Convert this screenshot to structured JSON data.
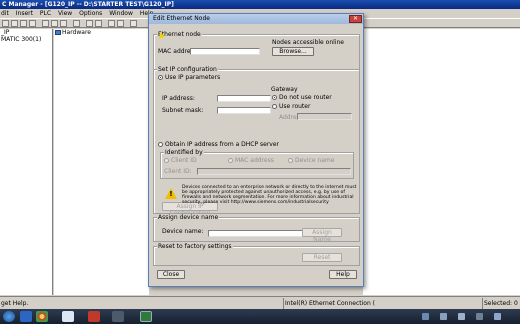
{
  "app": {
    "title": "C Manager - [G120_IP -- D:\\STARTER TEST\\G120_IP]",
    "menu": [
      "dit",
      "Insert",
      "PLC",
      "View",
      "Options",
      "Window",
      "Help"
    ],
    "tree": [
      "_IP",
      "MATIC 300(1)"
    ],
    "hardware_label": "Hardware",
    "status_left": "get Help.",
    "status_mid": "Intel(R) Ethernet Connection (",
    "status_right": "Selected: 0 / 1"
  },
  "dialog": {
    "title": "Edit Ethernet Node",
    "close_glyph": "✕",
    "ethernet_node": {
      "group_label": "Ethernet node",
      "nodes_online_label": "Nodes accessible online",
      "mac_label": "MAC address:",
      "mac_value": "",
      "browse_label": "Browse..."
    },
    "ip_config": {
      "group_label": "Set IP configuration",
      "use_ip_label": "Use IP parameters",
      "ip_label": "IP address:",
      "ip_value": "",
      "subnet_label": "Subnet mask:",
      "subnet_value": "",
      "gateway_label": "Gateway",
      "no_router_label": "Do not use router",
      "use_router_label": "Use router",
      "address_label": "Address:",
      "address_value": "",
      "dhcp_label": "Obtain IP address from a DHCP server",
      "identified_by_label": "Identified by",
      "client_id_option": "Client ID",
      "mac_option": "MAC address",
      "device_name_option": "Device name",
      "client_id_label": "Client ID:",
      "client_id_value": "",
      "warning_text": "Devices connected to an enterprise network or directly to the internet must be appropriately protected against unauthorized access, e.g. by use of firewalls and network segmentation. For more information about industrial security, please visit http://www.siemens.com/industrialsecurity",
      "assign_ip_label": "Assign IP Configuration"
    },
    "device_name": {
      "group_label": "Assign device name",
      "device_name_label": "Device name:",
      "device_name_value": "",
      "assign_name_label": "Assign Name"
    },
    "factory": {
      "group_label": "Reset to factory settings",
      "reset_label": "Reset"
    },
    "close_label": "Close",
    "help_label": "Help"
  },
  "colors": {
    "titlebar": "#0a2a80",
    "dialog_title": "#b8cde8",
    "warning": "#f0c000",
    "taskbar": "#16202e"
  }
}
